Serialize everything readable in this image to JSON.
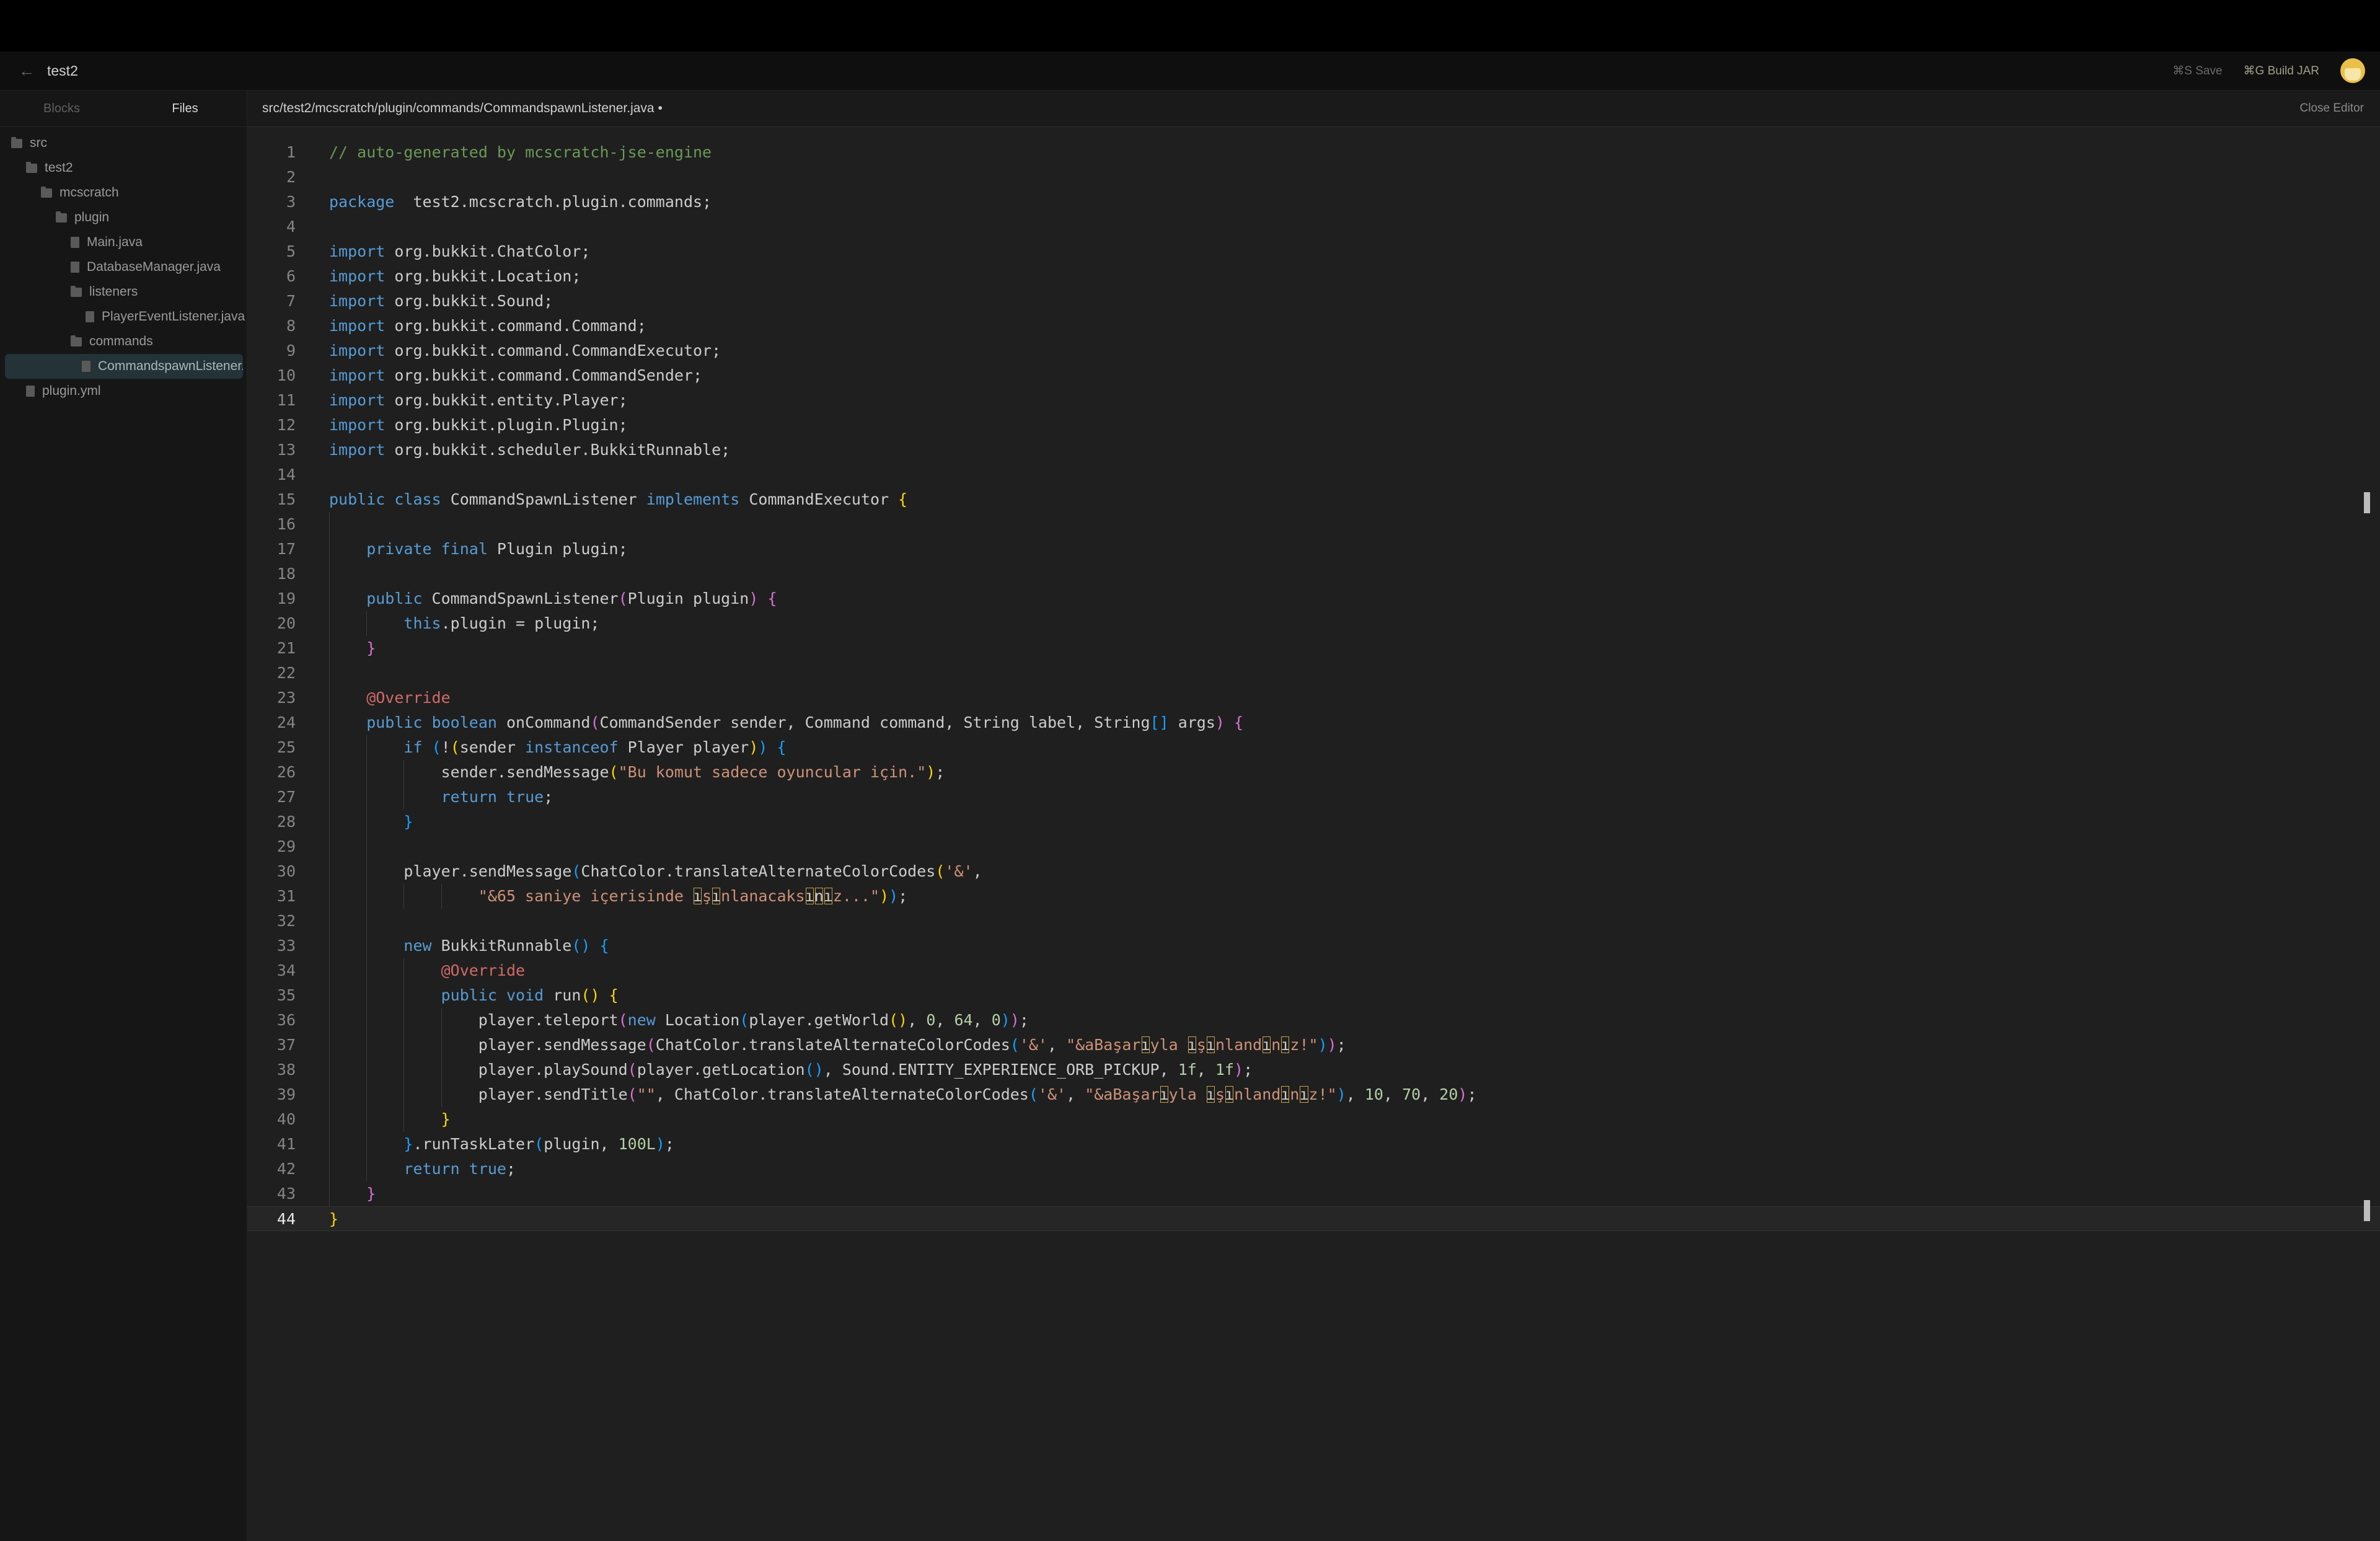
{
  "titlebar": {
    "back_icon": "←",
    "project": "test2",
    "save": "⌘S Save",
    "build": "⌘G Build JAR"
  },
  "sidebar": {
    "tabs": [
      {
        "label": "Blocks",
        "active": false
      },
      {
        "label": "Files",
        "active": true
      }
    ],
    "tree": [
      {
        "label": "src",
        "type": "folder",
        "depth": 0
      },
      {
        "label": "test2",
        "type": "folder",
        "depth": 1
      },
      {
        "label": "mcscratch",
        "type": "folder",
        "depth": 2
      },
      {
        "label": "plugin",
        "type": "folder",
        "depth": 3
      },
      {
        "label": "Main.java",
        "type": "file",
        "depth": 4
      },
      {
        "label": "DatabaseManager.java",
        "type": "file",
        "depth": 4
      },
      {
        "label": "listeners",
        "type": "folder",
        "depth": 4
      },
      {
        "label": "PlayerEventListener.java",
        "type": "file",
        "depth": 5
      },
      {
        "label": "commands",
        "type": "folder",
        "depth": 4
      },
      {
        "label": "CommandspawnListener.java",
        "type": "file",
        "depth": 5,
        "selected": true
      },
      {
        "label": "plugin.yml",
        "type": "file",
        "depth": 1
      }
    ]
  },
  "editor": {
    "path": "src/test2/mcscratch/plugin/commands/CommandspawnListener.java •",
    "close_label": "Close Editor",
    "current_line": 44,
    "lines": [
      {
        "n": 1,
        "i": 0,
        "t": [
          [
            "cm",
            "// auto-generated by mcscratch-jse-engine"
          ]
        ]
      },
      {
        "n": 2,
        "i": 0,
        "t": []
      },
      {
        "n": 3,
        "i": 0,
        "t": [
          [
            "kw",
            "package"
          ],
          [
            "",
            "  test2.mcscratch.plugin.commands;"
          ]
        ]
      },
      {
        "n": 4,
        "i": 0,
        "t": []
      },
      {
        "n": 5,
        "i": 0,
        "t": [
          [
            "kw",
            "import"
          ],
          [
            "",
            " org.bukkit.ChatColor;"
          ]
        ]
      },
      {
        "n": 6,
        "i": 0,
        "t": [
          [
            "kw",
            "import"
          ],
          [
            "",
            " org.bukkit.Location;"
          ]
        ]
      },
      {
        "n": 7,
        "i": 0,
        "t": [
          [
            "kw",
            "import"
          ],
          [
            "",
            " org.bukkit.Sound;"
          ]
        ]
      },
      {
        "n": 8,
        "i": 0,
        "t": [
          [
            "kw",
            "import"
          ],
          [
            "",
            " org.bukkit.command.Command;"
          ]
        ]
      },
      {
        "n": 9,
        "i": 0,
        "t": [
          [
            "kw",
            "import"
          ],
          [
            "",
            " org.bukkit.command.CommandExecutor;"
          ]
        ]
      },
      {
        "n": 10,
        "i": 0,
        "t": [
          [
            "kw",
            "import"
          ],
          [
            "",
            " org.bukkit.command.CommandSender;"
          ]
        ]
      },
      {
        "n": 11,
        "i": 0,
        "t": [
          [
            "kw",
            "import"
          ],
          [
            "",
            " org.bukkit.entity.Player;"
          ]
        ]
      },
      {
        "n": 12,
        "i": 0,
        "t": [
          [
            "kw",
            "import"
          ],
          [
            "",
            " org.bukkit.plugin.Plugin;"
          ]
        ]
      },
      {
        "n": 13,
        "i": 0,
        "t": [
          [
            "kw",
            "import"
          ],
          [
            "",
            " org.bukkit.scheduler.BukkitRunnable;"
          ]
        ]
      },
      {
        "n": 14,
        "i": 0,
        "t": []
      },
      {
        "n": 15,
        "i": 0,
        "t": [
          [
            "kw",
            "public"
          ],
          [
            "",
            " "
          ],
          [
            "kw",
            "class"
          ],
          [
            "",
            " CommandSpawnListener "
          ],
          [
            "kw",
            "implements"
          ],
          [
            "",
            " CommandExecutor "
          ],
          [
            "pb",
            "{"
          ]
        ]
      },
      {
        "n": 16,
        "i": 1,
        "t": []
      },
      {
        "n": 17,
        "i": 1,
        "t": [
          [
            "kw",
            "private"
          ],
          [
            "",
            " "
          ],
          [
            "kw",
            "final"
          ],
          [
            "",
            " Plugin plugin;"
          ]
        ]
      },
      {
        "n": 18,
        "i": 1,
        "t": []
      },
      {
        "n": 19,
        "i": 1,
        "t": [
          [
            "kw",
            "public"
          ],
          [
            "",
            " CommandSpawnListener"
          ],
          [
            "pp",
            "("
          ],
          [
            "",
            "Plugin plugin"
          ],
          [
            "pp",
            ")"
          ],
          [
            "",
            " "
          ],
          [
            "pp",
            "{"
          ]
        ]
      },
      {
        "n": 20,
        "i": 2,
        "t": [
          [
            "kw",
            "this"
          ],
          [
            "",
            ".plugin = plugin;"
          ]
        ]
      },
      {
        "n": 21,
        "i": 1,
        "t": [
          [
            "pp",
            "}"
          ]
        ]
      },
      {
        "n": 22,
        "i": 1,
        "t": []
      },
      {
        "n": 23,
        "i": 1,
        "t": [
          [
            "an",
            "@Override"
          ]
        ]
      },
      {
        "n": 24,
        "i": 1,
        "t": [
          [
            "kw",
            "public"
          ],
          [
            "",
            " "
          ],
          [
            "kw",
            "boolean"
          ],
          [
            "",
            " onCommand"
          ],
          [
            "pp",
            "("
          ],
          [
            "",
            "CommandSender sender, Command command, String label, String"
          ],
          [
            "pu",
            "[]"
          ],
          [
            "",
            " args"
          ],
          [
            "pp",
            ")"
          ],
          [
            "",
            " "
          ],
          [
            "pp",
            "{"
          ]
        ]
      },
      {
        "n": 25,
        "i": 2,
        "t": [
          [
            "kw",
            "if"
          ],
          [
            "",
            " "
          ],
          [
            "pu",
            "("
          ],
          [
            "",
            "!"
          ],
          [
            "pb",
            "("
          ],
          [
            "",
            "sender "
          ],
          [
            "kw",
            "instanceof"
          ],
          [
            "",
            " Player player"
          ],
          [
            "pb",
            ")"
          ],
          [
            "pu",
            ")"
          ],
          [
            "",
            " "
          ],
          [
            "pu",
            "{"
          ]
        ]
      },
      {
        "n": 26,
        "i": 3,
        "t": [
          [
            "",
            "sender.sendMessage"
          ],
          [
            "pb",
            "("
          ],
          [
            "st",
            "\"Bu komut sadece oyuncular için.\""
          ],
          [
            "pb",
            ")"
          ],
          [
            "",
            ";"
          ]
        ]
      },
      {
        "n": 27,
        "i": 3,
        "t": [
          [
            "kw",
            "return"
          ],
          [
            "",
            " "
          ],
          [
            "kw",
            "true"
          ],
          [
            "",
            ";"
          ]
        ]
      },
      {
        "n": 28,
        "i": 2,
        "t": [
          [
            "pu",
            "}"
          ]
        ]
      },
      {
        "n": 29,
        "i": 2,
        "t": []
      },
      {
        "n": 30,
        "i": 2,
        "t": [
          [
            "",
            "player.sendMessage"
          ],
          [
            "pu",
            "("
          ],
          [
            "",
            "ChatColor.translateAlternateColorCodes"
          ],
          [
            "pb",
            "("
          ],
          [
            "st",
            "'&'"
          ],
          [
            "",
            ","
          ]
        ]
      },
      {
        "n": 31,
        "i": 4,
        "t": [
          [
            "st",
            "\"&65 saniye içerisinde "
          ],
          [
            "bad",
            "ı"
          ],
          [
            "st",
            "ş"
          ],
          [
            "bad",
            "ı"
          ],
          [
            "st",
            "nlanacaks"
          ],
          [
            "bad",
            "ı"
          ],
          [
            "bad",
            "n"
          ],
          [
            "bad",
            "ı"
          ],
          [
            "st",
            "z...\""
          ],
          [
            "pb",
            ")"
          ],
          [
            "pu",
            ")"
          ],
          [
            "",
            ";"
          ]
        ]
      },
      {
        "n": 32,
        "i": 2,
        "t": []
      },
      {
        "n": 33,
        "i": 2,
        "t": [
          [
            "kw",
            "new"
          ],
          [
            "",
            " BukkitRunnable"
          ],
          [
            "pu",
            "()"
          ],
          [
            "",
            " "
          ],
          [
            "pu",
            "{"
          ]
        ]
      },
      {
        "n": 34,
        "i": 3,
        "t": [
          [
            "an",
            "@Override"
          ]
        ]
      },
      {
        "n": 35,
        "i": 3,
        "t": [
          [
            "kw",
            "public"
          ],
          [
            "",
            " "
          ],
          [
            "kw",
            "void"
          ],
          [
            "",
            " run"
          ],
          [
            "pb",
            "()"
          ],
          [
            "",
            " "
          ],
          [
            "pb",
            "{"
          ]
        ]
      },
      {
        "n": 36,
        "i": 4,
        "t": [
          [
            "",
            "player.teleport"
          ],
          [
            "pp",
            "("
          ],
          [
            "kw",
            "new"
          ],
          [
            "",
            " Location"
          ],
          [
            "pu",
            "("
          ],
          [
            "",
            "player.getWorld"
          ],
          [
            "pb",
            "()"
          ],
          [
            "",
            ", "
          ],
          [
            "nu",
            "0"
          ],
          [
            "",
            ", "
          ],
          [
            "nu",
            "64"
          ],
          [
            "",
            ", "
          ],
          [
            "nu",
            "0"
          ],
          [
            "pu",
            ")"
          ],
          [
            "pp",
            ")"
          ],
          [
            "",
            ";"
          ]
        ]
      },
      {
        "n": 37,
        "i": 4,
        "t": [
          [
            "",
            "player.sendMessage"
          ],
          [
            "pp",
            "("
          ],
          [
            "",
            "ChatColor.translateAlternateColorCodes"
          ],
          [
            "pu",
            "("
          ],
          [
            "st",
            "'&'"
          ],
          [
            "",
            ", "
          ],
          [
            "st",
            "\"&aBaşar"
          ],
          [
            "bad",
            "ı"
          ],
          [
            "st",
            "yla "
          ],
          [
            "bad",
            "ı"
          ],
          [
            "st",
            "ş"
          ],
          [
            "bad",
            "ı"
          ],
          [
            "st",
            "nland"
          ],
          [
            "bad",
            "ı"
          ],
          [
            "st",
            "n"
          ],
          [
            "bad",
            "ı"
          ],
          [
            "st",
            "z!\""
          ],
          [
            "pu",
            ")"
          ],
          [
            "pp",
            ")"
          ],
          [
            "",
            ";"
          ]
        ]
      },
      {
        "n": 38,
        "i": 4,
        "t": [
          [
            "",
            "player.playSound"
          ],
          [
            "pp",
            "("
          ],
          [
            "",
            "player.getLocation"
          ],
          [
            "pu",
            "()"
          ],
          [
            "",
            ", Sound.ENTITY_EXPERIENCE_ORB_PICKUP, "
          ],
          [
            "nu",
            "1f"
          ],
          [
            "",
            ", "
          ],
          [
            "nu",
            "1f"
          ],
          [
            "pp",
            ")"
          ],
          [
            "",
            ";"
          ]
        ]
      },
      {
        "n": 39,
        "i": 4,
        "t": [
          [
            "",
            "player.sendTitle"
          ],
          [
            "pp",
            "("
          ],
          [
            "st",
            "\"\""
          ],
          [
            "",
            ", ChatColor.translateAlternateColorCodes"
          ],
          [
            "pu",
            "("
          ],
          [
            "st",
            "'&'"
          ],
          [
            "",
            ", "
          ],
          [
            "st",
            "\"&aBaşar"
          ],
          [
            "bad",
            "ı"
          ],
          [
            "st",
            "yla "
          ],
          [
            "bad",
            "ı"
          ],
          [
            "st",
            "ş"
          ],
          [
            "bad",
            "ı"
          ],
          [
            "st",
            "nland"
          ],
          [
            "bad",
            "ı"
          ],
          [
            "st",
            "n"
          ],
          [
            "bad",
            "ı"
          ],
          [
            "st",
            "z!\""
          ],
          [
            "pu",
            ")"
          ],
          [
            "",
            ", "
          ],
          [
            "nu",
            "10"
          ],
          [
            "",
            ", "
          ],
          [
            "nu",
            "70"
          ],
          [
            "",
            ", "
          ],
          [
            "nu",
            "20"
          ],
          [
            "pp",
            ")"
          ],
          [
            "",
            ";"
          ]
        ]
      },
      {
        "n": 40,
        "i": 3,
        "t": [
          [
            "pb",
            "}"
          ]
        ]
      },
      {
        "n": 41,
        "i": 2,
        "t": [
          [
            "pu",
            "}"
          ],
          [
            "",
            ".runTaskLater"
          ],
          [
            "pu",
            "("
          ],
          [
            "",
            "plugin, "
          ],
          [
            "nu",
            "100L"
          ],
          [
            "pu",
            ")"
          ],
          [
            "",
            ";"
          ]
        ]
      },
      {
        "n": 42,
        "i": 2,
        "t": [
          [
            "kw",
            "return"
          ],
          [
            "",
            " "
          ],
          [
            "kw",
            "true"
          ],
          [
            "",
            ";"
          ]
        ]
      },
      {
        "n": 43,
        "i": 1,
        "t": [
          [
            "pp",
            "}"
          ]
        ]
      },
      {
        "n": 44,
        "i": 0,
        "t": [
          [
            "pb",
            "}"
          ]
        ]
      }
    ]
  },
  "colors": {
    "keyword": "#569cd6",
    "comment": "#6a9955",
    "string": "#ce9178",
    "number": "#b5cea8",
    "annotation": "#d16969",
    "selection": "#233338"
  }
}
